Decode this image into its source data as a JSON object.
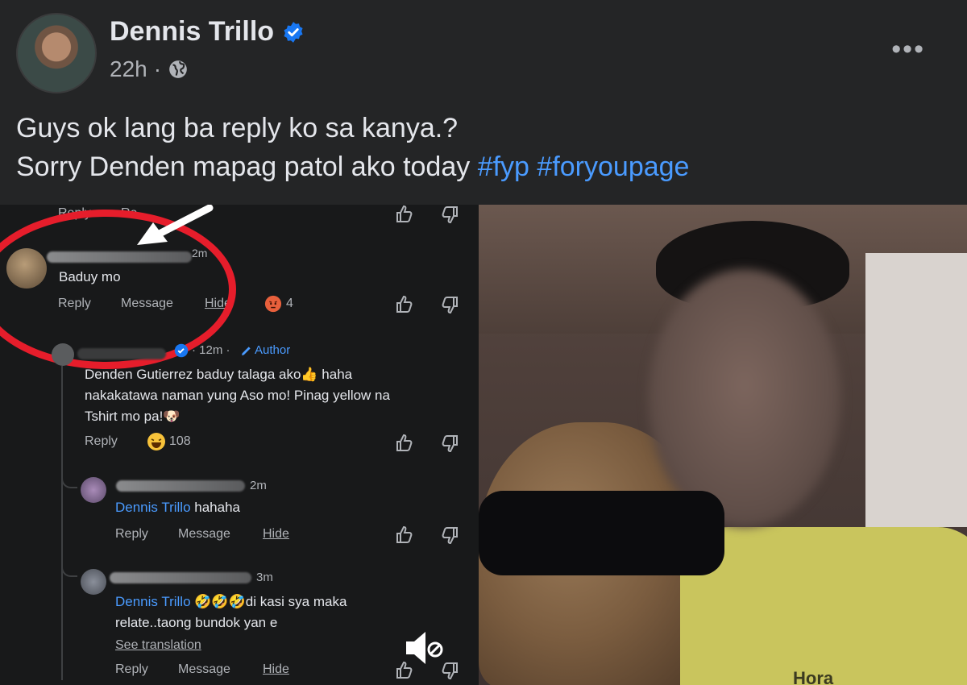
{
  "post": {
    "author": "Dennis Trillo",
    "time": "22h",
    "separator": "·",
    "more": "•••",
    "caption_line1": "Guys ok lang ba reply ko sa kanya.?",
    "caption_line2_text": "Sorry Denden mapag patol ako today",
    "hashtags": [
      "#fyp",
      "#foryoupage"
    ]
  },
  "comments_panel": {
    "top_reply": "Reply",
    "top_reply_partial": "Re",
    "comment1": {
      "time_partial": "2m",
      "text": "Baduy mo",
      "actions": [
        "Reply",
        "Message",
        "Hide"
      ],
      "reaction_count": "4"
    },
    "author_reply": {
      "time": "· 12m ·",
      "author_badge": "Author",
      "mention": "Denden Gutierrez",
      "text_line1": " baduy talaga ako👍 haha",
      "text_line2": "nakakatawa naman yung Aso mo! Pinag yellow na",
      "text_line3": "Tshirt mo pa!🐶",
      "action": "Reply",
      "reaction_count": "108"
    },
    "reply2": {
      "time": "2m",
      "mention": "Dennis Trillo",
      "text": " hahaha",
      "actions": [
        "Reply",
        "Message",
        "Hide"
      ]
    },
    "reply3": {
      "time": "3m",
      "mention": "Dennis Trillo",
      "text_line1": " 🤣🤣🤣di kasi sya maka",
      "text_line2": "relate..taong bundok yan e",
      "see_translation": "See translation",
      "actions": [
        "Reply",
        "Message",
        "Hide"
      ]
    }
  },
  "photo": {
    "shirt_text": "Hora"
  },
  "colors": {
    "background": "#242526",
    "link_blue": "#4a9bff",
    "annotation_red": "#e61d2b",
    "verified_blue": "#1877f2"
  }
}
